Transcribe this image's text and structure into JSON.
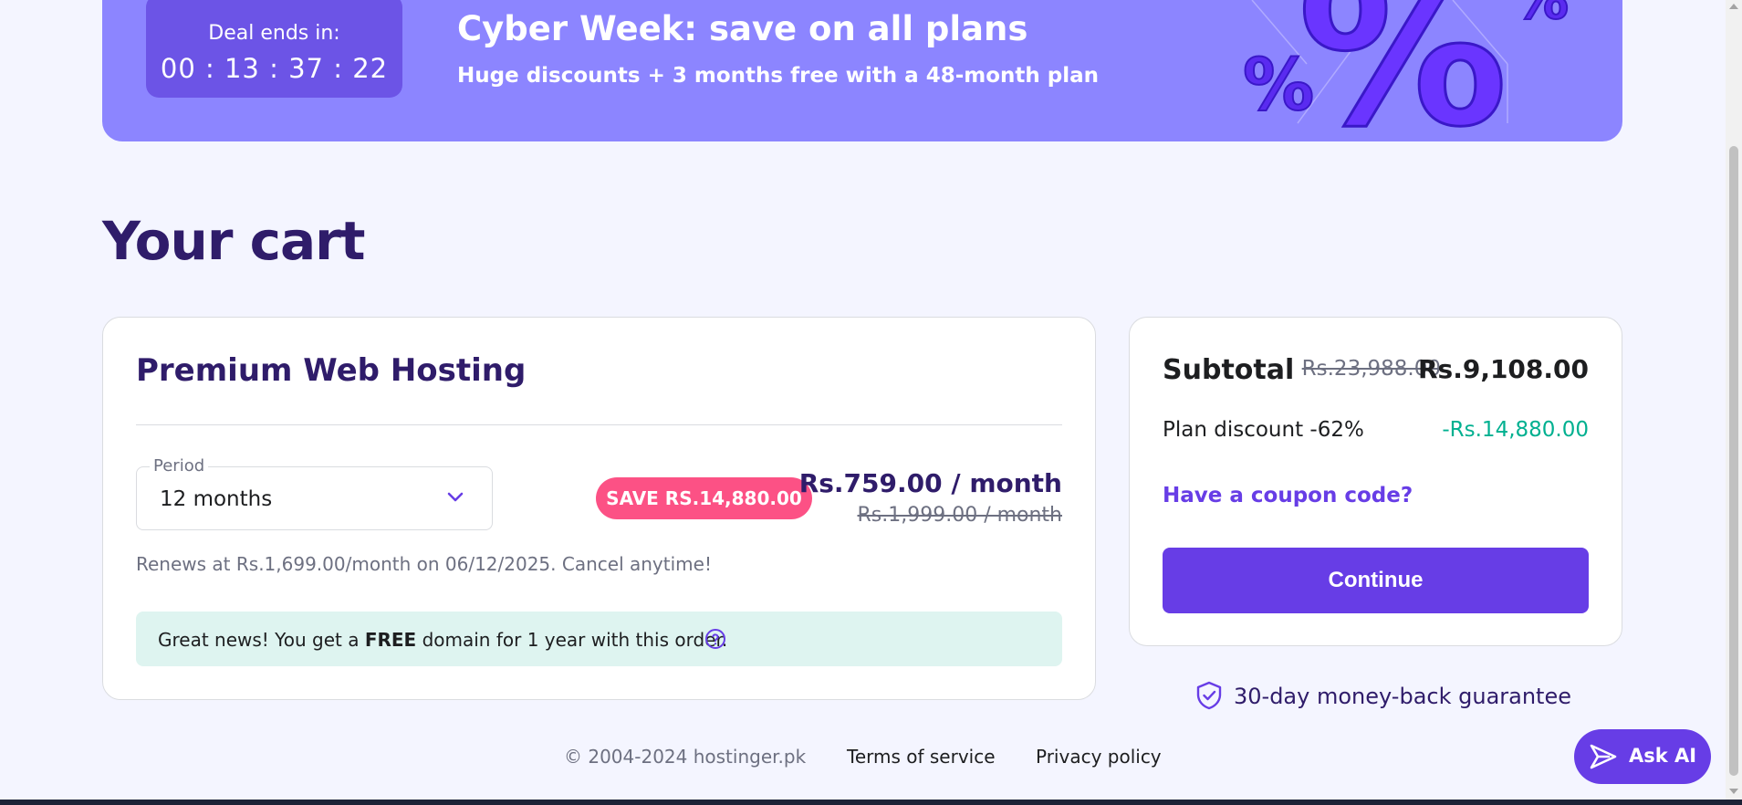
{
  "banner": {
    "deal_label": "Deal ends in:",
    "timer": "00 : 13 : 37 : 22",
    "title": "Cyber Week: save on all plans",
    "subtitle": "Huge discounts + 3 months free with a 48-month plan",
    "bg_color": "#8c85ff"
  },
  "page_title": "Your cart",
  "product": {
    "name": "Premium Web Hosting",
    "period_label": "Period",
    "period_value": "12 months",
    "save_badge": "SAVE RS.14,880.00",
    "price_now": "Rs.759.00 / month",
    "price_old": "Rs.1,999.00 / month",
    "renew_text": "Renews at Rs.1,699.00/month on 06/12/2025. Cancel anytime!",
    "domain_prefix": "Great news! You get a ",
    "domain_bold": "FREE",
    "domain_suffix": " domain for 1 year with this order."
  },
  "summary": {
    "subtotal_label": "Subtotal",
    "subtotal_old": "Rs.23,988.00",
    "subtotal_new": "Rs.9,108.00",
    "discount_label": "Plan discount -62%",
    "discount_value": "-Rs.14,880.00",
    "coupon_link": "Have a coupon code?",
    "continue_label": "Continue"
  },
  "guarantee": "30-day money-back guarantee",
  "footer": {
    "copyright": "© 2004-2024 hostinger.pk",
    "terms": "Terms of service",
    "privacy": "Privacy policy"
  },
  "ask_ai": "Ask AI",
  "colors": {
    "brand": "#673de6",
    "heading": "#2f1c6a",
    "badge": "#fc5185",
    "discount": "#00b090",
    "domain_bg": "#def4f0"
  }
}
